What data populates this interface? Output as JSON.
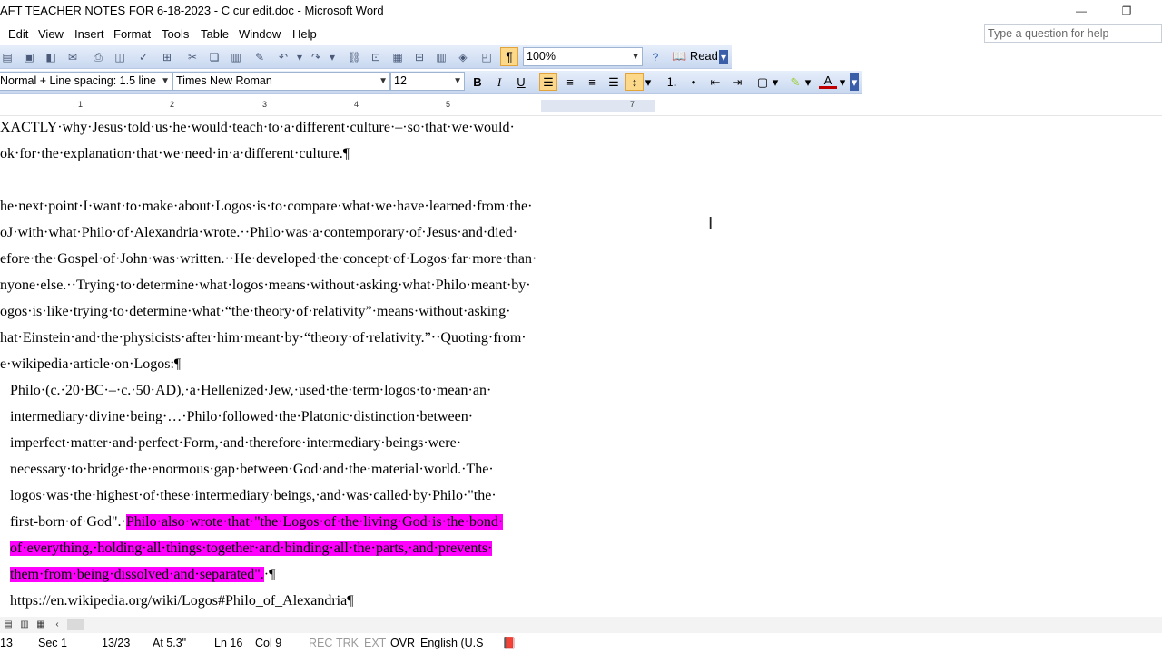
{
  "window": {
    "title": "AFT TEACHER NOTES FOR 6-18-2023 - C cur edit.doc - Microsoft Word",
    "minimize": "—",
    "restore": "❐"
  },
  "menu": {
    "items": [
      "Edit",
      "View",
      "Insert",
      "Format",
      "Tools",
      "Table",
      "Window",
      "Help"
    ],
    "help_placeholder": "Type a question for help"
  },
  "standard_toolbar": {
    "zoom": "100%",
    "read_label": "Read",
    "pilcrow": "¶"
  },
  "formatting_toolbar": {
    "style": "Normal + Line spacing:  1.5 line",
    "font": "Times New Roman",
    "size": "12",
    "bold": "B",
    "italic": "I",
    "underline": "U"
  },
  "ruler": {
    "numbers": [
      "1",
      "2",
      "3",
      "4",
      "5",
      "7"
    ]
  },
  "document": {
    "lines": [
      "XACTLY·why·Jesus·told·us·he·would·teach·to·a·different·culture·–·so·that·we·would·",
      "ok·for·the·explanation·that·we·need·in·a·different·culture.¶",
      "",
      "he·next·point·I·want·to·make·about·Logos·is·to·compare·what·we·have·learned·from·the·",
      "oJ·with·what·Philo·of·Alexandria·wrote.··Philo·was·a·contemporary·of·Jesus·and·died·",
      "efore·the·Gospel·of·John·was·written.··He·developed·the·concept·of·Logos·far·more·than·",
      "nyone·else.··Trying·to·determine·what·logos·means·without·asking·what·Philo·meant·by·",
      "ogos·is·like·trying·to·determine·what·“the·theory·of·relativity”·means·without·asking·",
      "hat·Einstein·and·the·physicists·after·him·meant·by·“theory·of·relativity.”··Quoting·from·",
      "e·wikipedia·article·on·Logos:¶"
    ],
    "quote_lines": [
      "Philo·(c.·20·BC·–·c.·50·AD),·a·Hellenized·Jew,·used·the·term·logos·to·mean·an·",
      "intermediary·divine·being·…·Philo·followed·the·Platonic·distinction·between·",
      "imperfect·matter·and·perfect·Form,·and·therefore·intermediary·beings·were·",
      "necessary·to·bridge·the·enormous·gap·between·God·and·the·material·world.·The·",
      "logos·was·the·highest·of·these·intermediary·beings,·and·was·called·by·Philo·\"the·"
    ],
    "quote_line6_plain": "first-born·of·God\".·",
    "quote_line6_hl": "Philo·also·wrote·that·\"the·Logos·of·the·living·God·is·the·bond·",
    "quote_line7_hl": "of·everything,·holding·all·things·together·and·binding·all·the·parts,·and·prevents·",
    "quote_line8_hl": "them·from·being·dissolved·and·separated\".",
    "quote_line8_tail": "·¶",
    "url_line": "https://en.wikipedia.org/wiki/Logos#Philo_of_Alexandria¶"
  },
  "status": {
    "page": "13",
    "section": "Sec 1",
    "pages": "13/23",
    "at": "At 5.3\"",
    "ln": "Ln 16",
    "col": "Col 9",
    "rec": "REC",
    "trk": "TRK",
    "ext": "EXT",
    "ovr": "OVR",
    "language": "English (U.S"
  },
  "colors": {
    "highlight": "#ff00ff",
    "toolbar": "#d6e2f5"
  }
}
